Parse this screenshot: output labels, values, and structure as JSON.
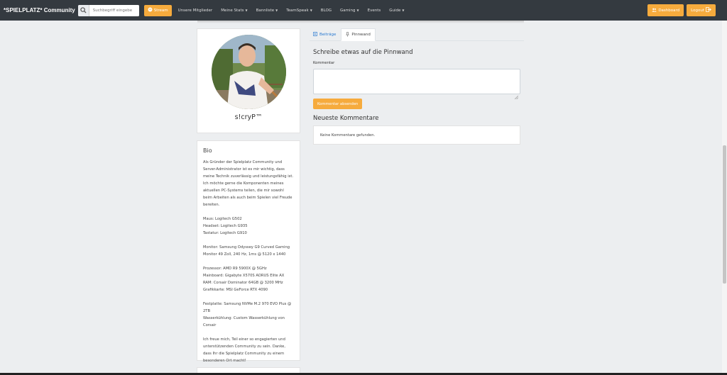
{
  "navbar": {
    "brand": "*SPIELPLATZ* Community",
    "search_placeholder": "Suchbegriff eingebe",
    "stream_label": "Stream",
    "items": [
      {
        "label": "Unsere Mitglieder",
        "dropdown": false
      },
      {
        "label": "Meine Stats",
        "dropdown": true
      },
      {
        "label": "Bannliste",
        "dropdown": true
      },
      {
        "label": "TeamSpeak",
        "dropdown": true
      },
      {
        "label": "BLOG",
        "dropdown": false
      },
      {
        "label": "Gaming",
        "dropdown": true
      },
      {
        "label": "Events",
        "dropdown": false
      },
      {
        "label": "Guide",
        "dropdown": true
      }
    ],
    "dashboard_label": "Dashboard",
    "logout_label": "Logout"
  },
  "profile": {
    "username": "s!cryP™"
  },
  "bio": {
    "title": "Bio",
    "text": "Als Gründer der Spielplatz Community und Server-Administrator ist es mir wichtig, dass meine Technik zuverlässig und leistungsfähig ist. Ich möchte gerne die Komponenten meines aktuellen PC-Systems teilen, die mir sowohl beim Arbeiten als auch beim Spielen viel Freude bereiten.\n\nMaus: Logitech G502\nHeadset: Logitech G935\nTastatur: Logitech G910\n\nMonitor: Samsung Odyssey G9 Curved Gaming Monitor 49 Zoll, 240 Hz, 1ms @ 5120 x 1440\n\nProzessor: AMD R9 5900X @ 5GHz\nMainboard: Gigabyte X570S AORUS Elite AX\nRAM: Corsair Dominator 64GB @ 3200 MHz\nGrafikkarte: MSI GeForce RTX 4090\n\nFestplatte: Samsung NVMe M.2 970 EVO Plus @ 2TB\nWasserkühlung: Custom Wasserkühlung von Corsair\n\nIch freue mich, Teil einer so engagierten und unterstützenden Community zu sein. Danke, dass Ihr die Spielplatz Community zu einem besonderen Ort macht!"
  },
  "tabs": [
    {
      "label": "Beiträge",
      "active": false
    },
    {
      "label": "Pinnwand",
      "active": true
    }
  ],
  "wall": {
    "heading": "Schreibe etwas auf die Pinnwand",
    "comment_label": "Kommentar",
    "submit_label": "Kommentar absenden",
    "newest_heading": "Neueste Kommentare",
    "empty_text": "Keine Kommentare gefunden."
  },
  "colors": {
    "accent": "#f6ab3d",
    "navbar": "#343a40",
    "link": "#2a7ad1"
  },
  "icons": {
    "search": "search-icon",
    "stream": "twitch-icon",
    "dashboard": "users-icon",
    "logout": "logout-icon",
    "posts_tab": "posts-icon",
    "wall_tab": "pin-icon"
  }
}
